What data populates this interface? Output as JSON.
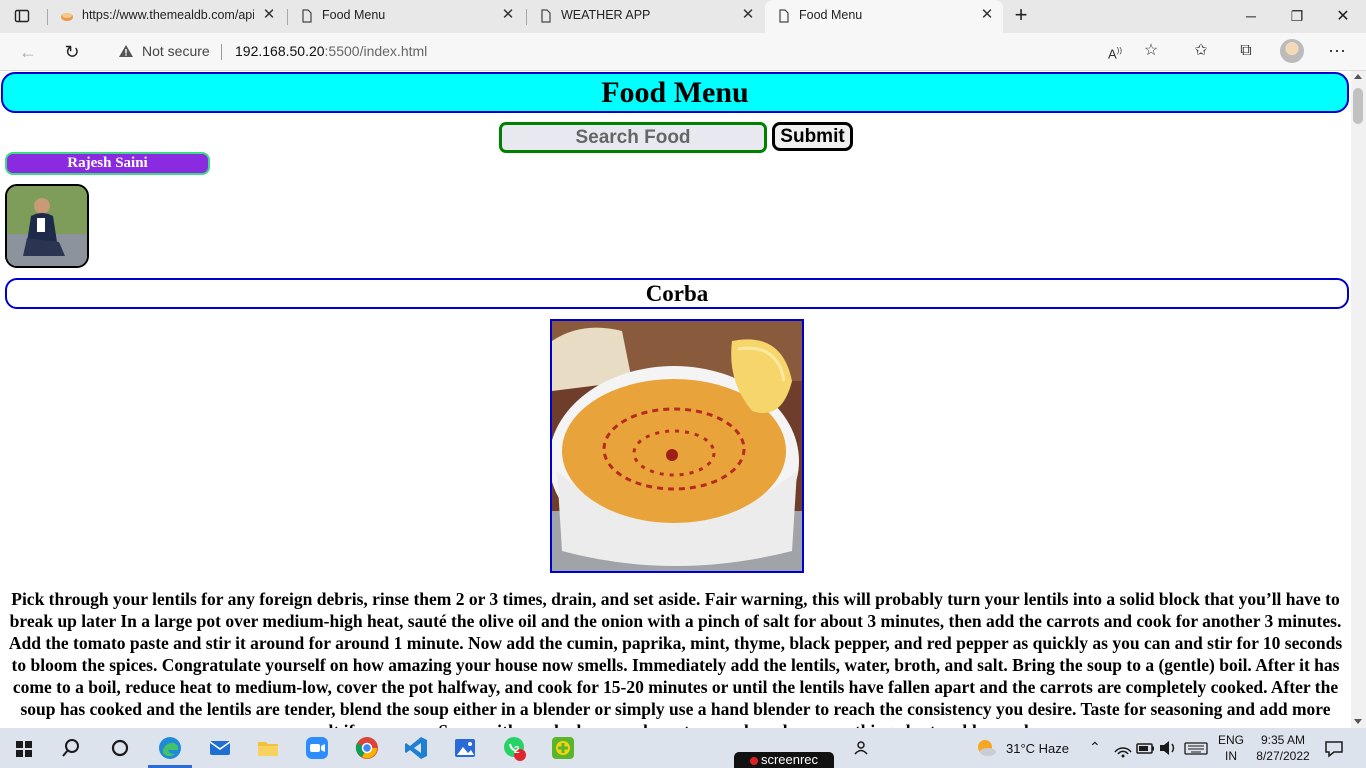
{
  "browser": {
    "tabs": [
      {
        "label": "https://www.themealdb.com/api",
        "active": false
      },
      {
        "label": "Food Menu",
        "active": false
      },
      {
        "label": "WEATHER APP",
        "active": false
      },
      {
        "label": "Food Menu",
        "active": true
      }
    ],
    "security_label": "Not secure",
    "url_host": "192.168.50.20",
    "url_rest": ":5500/index.html"
  },
  "page": {
    "title": "Food Menu",
    "search_placeholder": "Search Food",
    "submit_label": "Submit",
    "user_name": "Rajesh Saini",
    "meal": {
      "name": "Corba",
      "instructions": "Pick through your lentils for any foreign debris, rinse them 2 or 3 times, drain, and set aside. Fair warning, this will probably turn your lentils into a solid block that you’ll have to break up later In a large pot over medium-high heat, sauté the olive oil and the onion with a pinch of salt for about 3 minutes, then add the carrots and cook for another 3 minutes. Add the tomato paste and stir it around for around 1 minute. Now add the cumin, paprika, mint, thyme, black pepper, and red pepper as quickly as you can and stir for 10 seconds to bloom the spices. Congratulate yourself on how amazing your house now smells. Immediately add the lentils, water, broth, and salt. Bring the soup to a (gentle) boil. After it has come to a boil, reduce heat to medium-low, cover the pot halfway, and cook for 15-20 minutes or until the lentils have fallen apart and the carrots are completely cooked. After the soup has cooked and the lentils are tender, blend the soup either in a blender or simply use a hand blender to reach the consistency you desire. Taste for seasoning and add more salt if necessary. Serve with crushed-up crackers, torn up bread, or something else to add crunch."
    }
  },
  "taskbar": {
    "weather": "31°C  Haze",
    "lang_line1": "ENG",
    "lang_line2": "IN",
    "time": "9:35 AM",
    "date": "8/27/2022",
    "notification_count": "2",
    "screenrec_label": "screenrec"
  },
  "colors": {
    "header_bg": "#00ffff",
    "header_border": "#0000cc",
    "badge_bg": "#8a2be2",
    "badge_border": "#3ddc84",
    "search_border": "#008000"
  }
}
